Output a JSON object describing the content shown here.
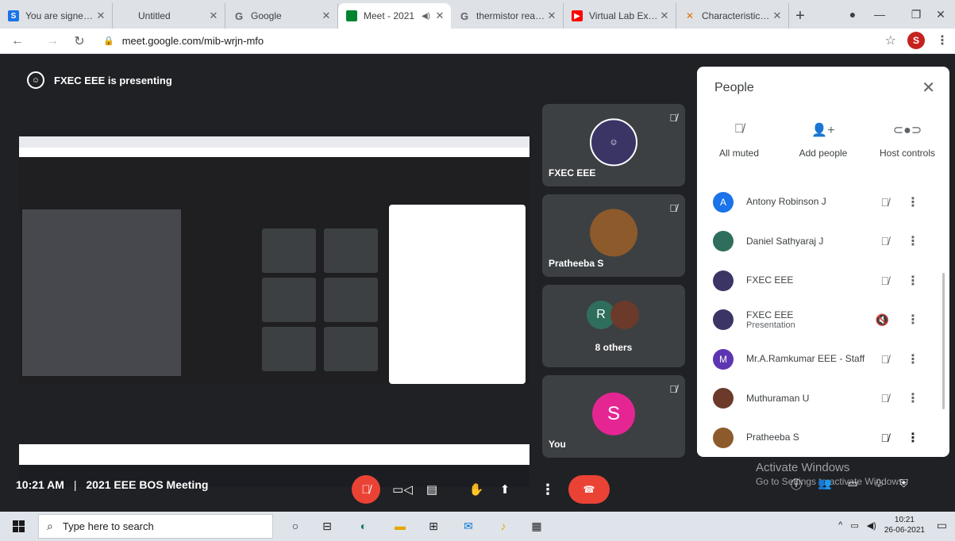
{
  "browser": {
    "tabs": [
      {
        "label": "You are signed in",
        "favicon": "S",
        "color": "#1a73e8"
      },
      {
        "label": "Untitled",
        "favicon": "",
        "color": "transparent"
      },
      {
        "label": "Google",
        "favicon": "G",
        "color": "#5f6368"
      },
      {
        "label": "Meet - 2021",
        "favicon": "",
        "color": "#00832d"
      },
      {
        "label": "thermistor readir",
        "favicon": "G",
        "color": "#5f6368"
      },
      {
        "label": "Virtual Lab Exper",
        "favicon": "",
        "color": "#ff0000"
      },
      {
        "label": "Characteristics o",
        "favicon": "",
        "color": "#e37400"
      }
    ],
    "url": "meet.google.com/mib-wrjn-mfo",
    "profile_initial": "S"
  },
  "meet": {
    "presenting_text": "FXEC EEE is presenting",
    "tiles": [
      {
        "name": "FXEC EEE"
      },
      {
        "name": "Pratheeba S"
      },
      {
        "name": "8 others",
        "initial": "R"
      },
      {
        "name": "You",
        "initial": "S"
      }
    ],
    "meeting_time": "10:21 AM",
    "meeting_name": "2021 EEE BOS Meeting",
    "activate_line1": "Activate Windows",
    "activate_line2": "Go to Settings to activate Windows."
  },
  "people_panel": {
    "title": "People",
    "actions": [
      "All muted",
      "Add people",
      "Host controls"
    ],
    "participants": [
      {
        "name": "Antony Robinson J",
        "sub": "",
        "initial": "A",
        "color": "#1a73e8"
      },
      {
        "name": "Daniel Sathyaraj J",
        "sub": "",
        "initial": "",
        "color": "#2f6e5c"
      },
      {
        "name": "FXEC EEE",
        "sub": "",
        "initial": "",
        "color": "#3b3566"
      },
      {
        "name": "FXEC EEE",
        "sub": "Presentation",
        "initial": "",
        "color": "#3b3566"
      },
      {
        "name": "Mr.A.Ramkumar EEE - Staff",
        "sub": "",
        "initial": "M",
        "color": "#5e35b1"
      },
      {
        "name": "Muthuraman U",
        "sub": "",
        "initial": "",
        "color": "#6b3a2a"
      },
      {
        "name": "Pratheeba S",
        "sub": "",
        "initial": "",
        "color": "#8d5a2b"
      }
    ]
  },
  "taskbar": {
    "search_placeholder": "Type here to search",
    "time": "10:21",
    "date": "26-06-2021"
  }
}
